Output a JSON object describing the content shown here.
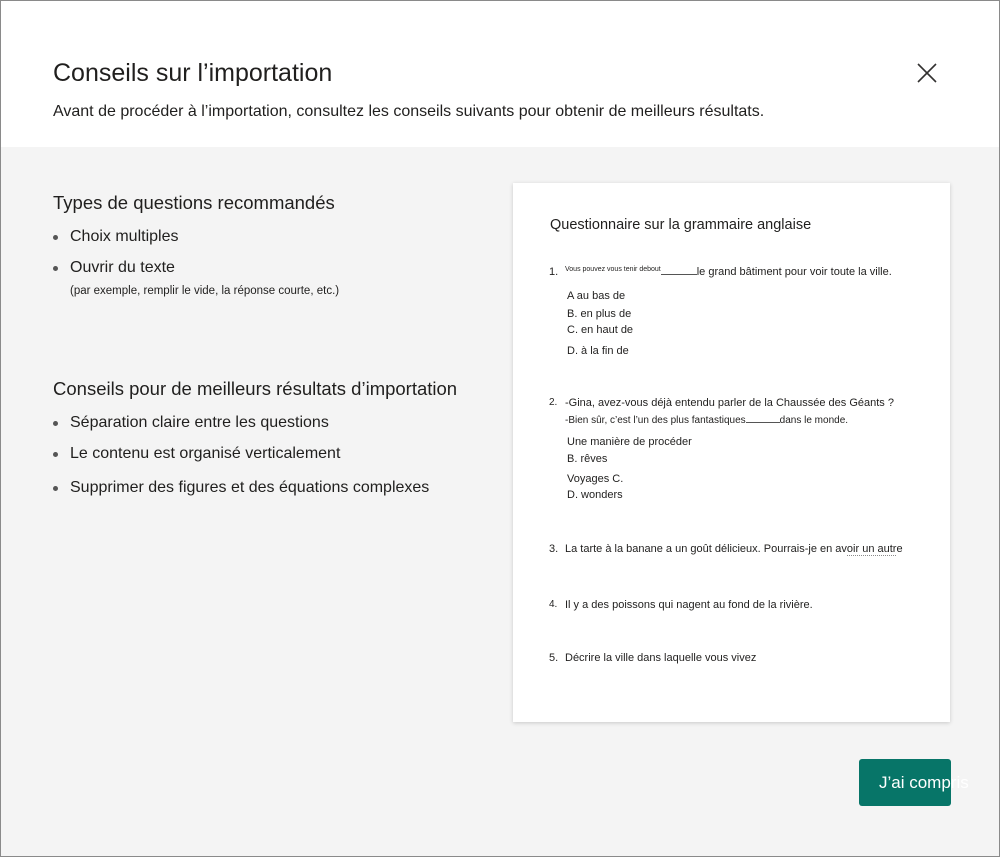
{
  "dialog": {
    "title": "Conseils sur l’importation",
    "subtitle": "Avant de procéder à l’importation, consultez les conseils suivants pour obtenir de meilleurs résultats.",
    "close_icon": "close-icon"
  },
  "recommended": {
    "title": "Types de questions recommandés",
    "items": [
      {
        "label": "Choix multiples"
      },
      {
        "label": "Ouvrir du texte",
        "note": "(par exemple, remplir le vide, la réponse courte, etc.)"
      }
    ]
  },
  "tips": {
    "title": "Conseils pour de meilleurs résultats d’importation",
    "items": [
      {
        "label": "Séparation claire entre les questions"
      },
      {
        "label": "Le contenu est organisé verticalement"
      },
      {
        "label": "Supprimer des figures et des équations complexes"
      }
    ]
  },
  "sample": {
    "quiz_title": "Questionnaire sur la grammaire anglaise",
    "questions": [
      {
        "num": "1.",
        "prefix": "Vous pouvez vous tenir debout",
        "text": "le grand bâtiment pour voir toute la ville.",
        "options": [
          "A au bas de",
          "B. en plus de",
          "C. en haut de",
          "D. à la fin de"
        ]
      },
      {
        "num": "2.",
        "line1": "-Gina, avez-vous déjà entendu parler de la Chaussée des Géants ?",
        "line2_start": "-Bien sûr, c’est l’un des plus fantastiques",
        "line2_end": "dans le monde.",
        "options": [
          "Une manière de procéder",
          "B. rêves",
          "Voyages C.",
          "D. wonders"
        ]
      },
      {
        "num": "3.",
        "text_start": "La tarte à la banane a un goût délicieux. Pourrais-je en av",
        "text_squiggle": "oir un autr",
        "text_end": "e"
      },
      {
        "num": "4.",
        "text": "Il y a des poissons qui nagent au fond de la rivière."
      },
      {
        "num": "5.",
        "text": "Décrire la ville dans laquelle vous vivez"
      }
    ]
  },
  "actions": {
    "confirm_label": "J’ai compris"
  }
}
